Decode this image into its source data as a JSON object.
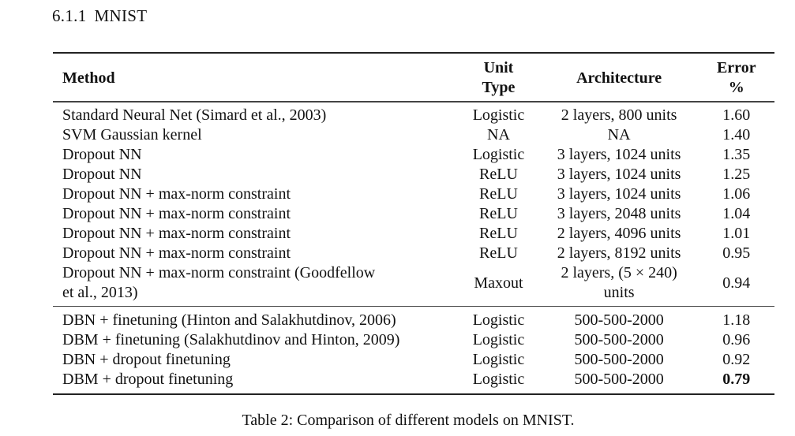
{
  "section": {
    "number": "6.1.1",
    "title": "MNIST"
  },
  "table": {
    "headers": {
      "method": "Method",
      "unit_type_line1": "Unit",
      "unit_type_line2": "Type",
      "architecture": "Architecture",
      "error_line1": "Error",
      "error_line2": "%"
    },
    "group1": [
      {
        "method": "Standard Neural Net (Simard et al., 2003)",
        "unit": "Logistic",
        "arch": "2 layers, 800 units",
        "error": "1.60"
      },
      {
        "method": "SVM Gaussian kernel",
        "unit": "NA",
        "arch": "NA",
        "error": "1.40"
      },
      {
        "method": "Dropout NN",
        "unit": "Logistic",
        "arch": "3 layers, 1024 units",
        "error": "1.35"
      },
      {
        "method": "Dropout NN",
        "unit": "ReLU",
        "arch": "3 layers, 1024 units",
        "error": "1.25"
      },
      {
        "method": "Dropout NN + max-norm constraint",
        "unit": "ReLU",
        "arch": "3 layers, 1024 units",
        "error": "1.06"
      },
      {
        "method": "Dropout NN + max-norm constraint",
        "unit": "ReLU",
        "arch": "3 layers, 2048 units",
        "error": "1.04"
      },
      {
        "method": "Dropout NN + max-norm constraint",
        "unit": "ReLU",
        "arch": "2 layers, 4096 units",
        "error": "1.01"
      },
      {
        "method": "Dropout NN + max-norm constraint",
        "unit": "ReLU",
        "arch": "2 layers, 8192 units",
        "error": "0.95"
      }
    ],
    "maxout_row": {
      "method_line1": "Dropout NN + max-norm constraint (Goodfellow",
      "method_line2": "et al., 2013)",
      "unit": "Maxout",
      "arch_line1": "2 layers, (5 × 240)",
      "arch_line2": "units",
      "error": "0.94"
    },
    "group2": [
      {
        "method": "DBN + finetuning (Hinton and Salakhutdinov, 2006)",
        "unit": "Logistic",
        "arch": "500-500-2000",
        "error": "1.18"
      },
      {
        "method": "DBM + finetuning (Salakhutdinov and Hinton, 2009)",
        "unit": "Logistic",
        "arch": "500-500-2000",
        "error": "0.96"
      },
      {
        "method": "DBN + dropout finetuning",
        "unit": "Logistic",
        "arch": "500-500-2000",
        "error": "0.92"
      },
      {
        "method": "DBM + dropout finetuning",
        "unit": "Logistic",
        "arch": "500-500-2000",
        "error": "0.79",
        "bold": true
      }
    ]
  },
  "caption": "Table 2: Comparison of different models on MNIST."
}
